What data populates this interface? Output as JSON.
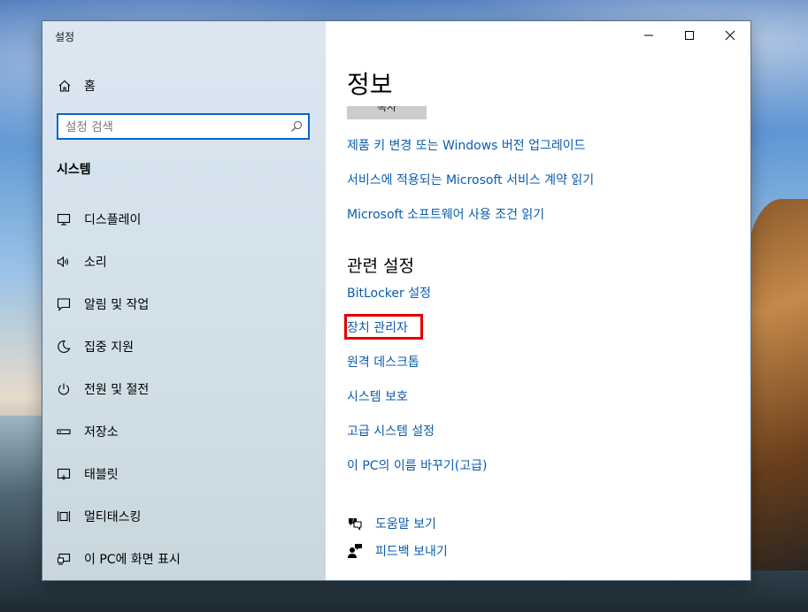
{
  "window": {
    "app_title": "설정",
    "controls": {
      "minimize": "minimize-icon",
      "maximize": "maximize-icon",
      "close": "close-icon"
    }
  },
  "sidebar": {
    "home_label": "홈",
    "search_placeholder": "설정 검색",
    "section_title": "시스템",
    "items": [
      {
        "label": "디스플레이",
        "icon": "monitor-icon"
      },
      {
        "label": "소리",
        "icon": "speaker-icon"
      },
      {
        "label": "알림 및 작업",
        "icon": "notification-icon"
      },
      {
        "label": "집중 지원",
        "icon": "moon-icon"
      },
      {
        "label": "전원 및 절전",
        "icon": "power-icon"
      },
      {
        "label": "저장소",
        "icon": "storage-icon"
      },
      {
        "label": "태블릿",
        "icon": "tablet-icon"
      },
      {
        "label": "멀티태스킹",
        "icon": "multitasking-icon"
      },
      {
        "label": "이 PC에 화면 표시",
        "icon": "project-icon"
      }
    ]
  },
  "content": {
    "title": "정보",
    "copy_button_label": "복사",
    "links": [
      "제품 키 변경 또는 Windows 버전 업그레이드",
      "서비스에 적용되는 Microsoft 서비스 계약 읽기",
      "Microsoft 소프트웨어 사용 조건 읽기"
    ],
    "related_title": "관련 설정",
    "related_links": [
      "BitLocker 설정",
      "장치 관리자",
      "원격 데스크톱",
      "시스템 보호",
      "고급 시스템 설정",
      "이 PC의 이름 바꾸기(고급)"
    ],
    "help_label": "도움말 보기",
    "feedback_label": "피드백 보내기"
  },
  "colors": {
    "link": "#0b5cad",
    "search_border": "#0a64c8",
    "highlight": "#e00000"
  }
}
